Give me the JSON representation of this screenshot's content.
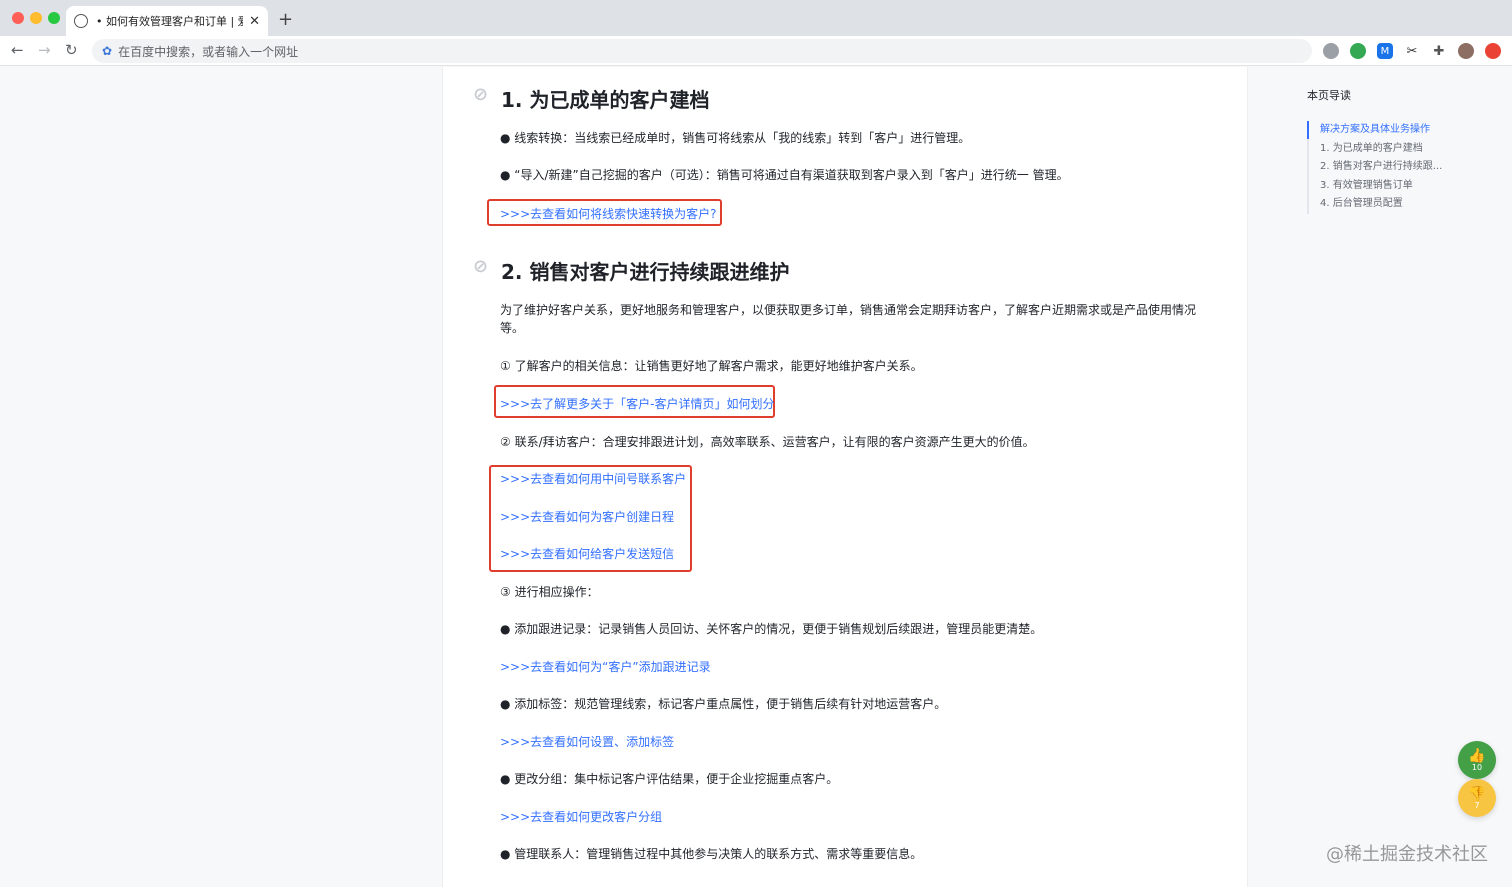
{
  "browser": {
    "tab_title": "• 如何有效管理客户和订单 | 爱番",
    "tab_close": "✕",
    "new_tab": "+",
    "omnibox_placeholder": "在百度中搜索，或者输入一个网址",
    "back": "←",
    "forward": "→",
    "reload": "↻"
  },
  "article": {
    "section1": {
      "heading": "1. 为已成单的客户建档",
      "bullets": [
        "● 线索转换：当线索已经成单时，销售可将线索从「我的线索」转到「客户」进行管理。",
        "● “导入/新建”自己挖掘的客户（可选）：销售可将通过自有渠道获取到客户录入到「客户」进行统一 管理。"
      ],
      "link": ">>>去查看如何将线索快速转换为客户?"
    },
    "section2": {
      "heading": "2. 销售对客户进行持续跟进维护",
      "intro": "为了维护好客户关系，更好地服务和管理客户，以便获取更多订单，销售通常会定期拜访客户，了解客户近期需求或是产品使用情况等。",
      "step1": "① 了解客户的相关信息：让销售更好地了解客户需求，能更好地维护客户关系。",
      "step1_link": ">>>去了解更多关于「客户-客户详情页」如何划分",
      "step2": "② 联系/拜访客户：合理安排跟进计划，高效率联系、运营客户，让有限的客户资源产生更大的价值。",
      "step2_links": [
        ">>>去查看如何用中间号联系客户",
        ">>>去查看如何为客户创建日程",
        ">>>去查看如何给客户发送短信"
      ],
      "step3": "③ 进行相应操作：",
      "ops": [
        {
          "text": "● 添加跟进记录：记录销售人员回访、关怀客户的情况，更便于销售规划后续跟进，管理员能更清楚。",
          "link": ">>>去查看如何为“客户”添加跟进记录"
        },
        {
          "text": "● 添加标签：规范管理线索，标记客户重点属性，便于销售后续有针对地运营客户。",
          "link": ">>>去查看如何设置、添加标签"
        },
        {
          "text": "● 更改分组：集中标记客户评估结果，便于企业挖掘重点客户。",
          "link": ">>>去查看如何更改客户分组"
        },
        {
          "text": "● 管理联系人：管理销售过程中其他参与决策人的联系方式、需求等重要信息。",
          "link": ""
        }
      ]
    }
  },
  "toc": {
    "title": "本页导读",
    "items": [
      "解决方案及具体业务操作",
      "1. 为已成单的客户建档",
      "2. 销售对客户进行持续跟...",
      "3. 有效管理销售订单",
      "4. 后台管理员配置"
    ]
  },
  "votes": {
    "up_count": "10",
    "down_count": "7"
  },
  "watermark": "@稀土掘金技术社区",
  "colors": {
    "link": "#3370ff",
    "highlight_box": "#e03e2d",
    "accent": "#3370ff"
  }
}
